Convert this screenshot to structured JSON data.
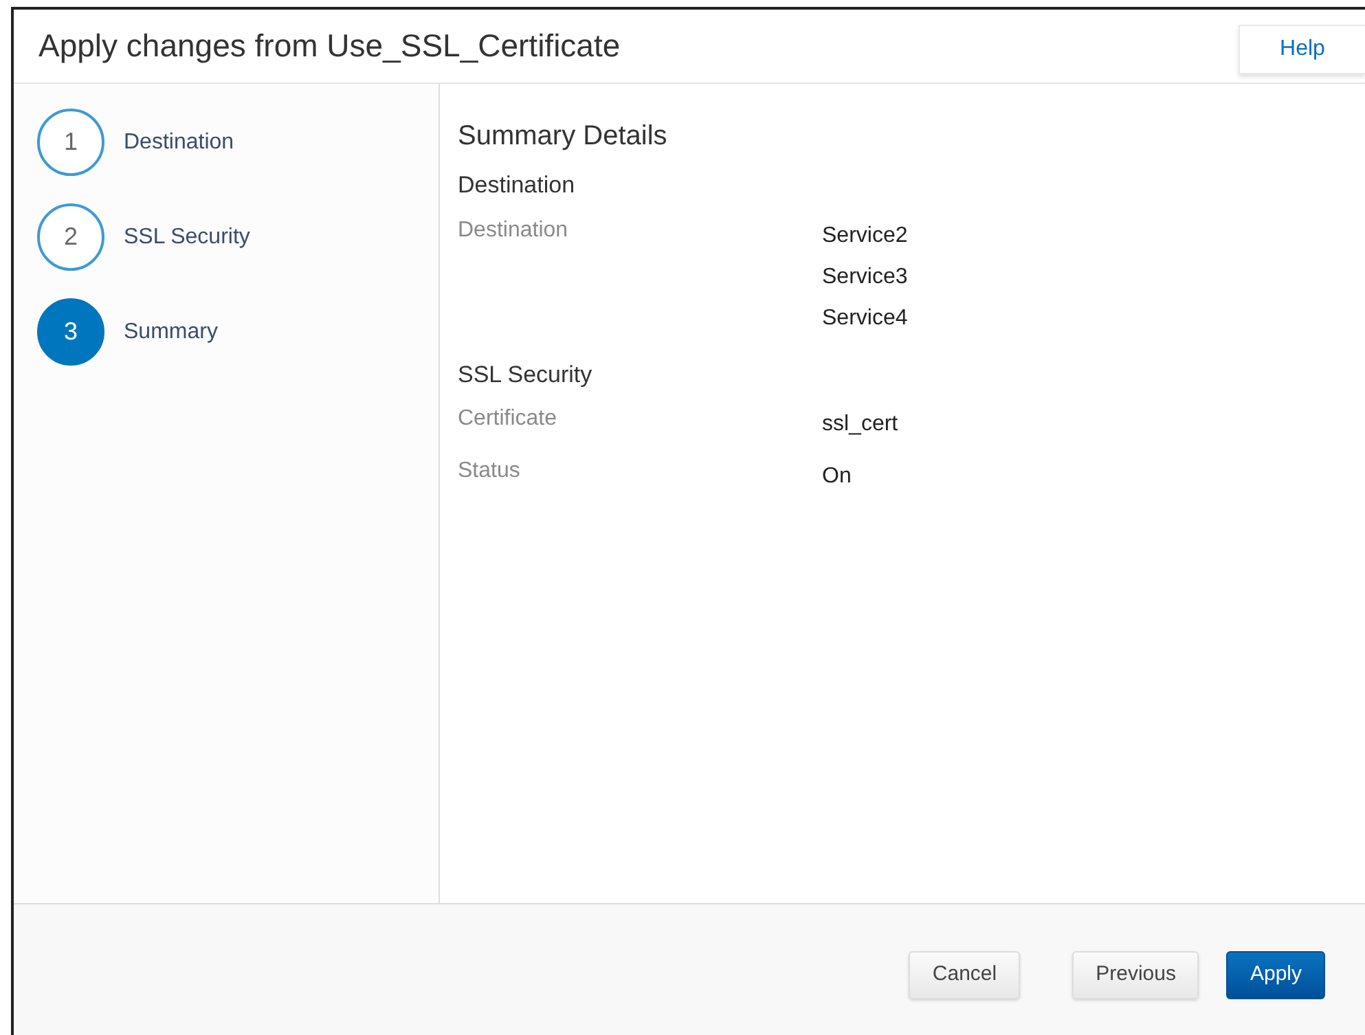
{
  "window": {
    "title": "Apply changes from Use_SSL_Certificate",
    "help_button": "Help"
  },
  "steps": [
    {
      "number": "1",
      "label": "Destination",
      "selected": false
    },
    {
      "number": "2",
      "label": "SSL Security",
      "selected": false
    },
    {
      "number": "3",
      "label": "Summary",
      "selected": true
    }
  ],
  "summary": {
    "heading": "Summary Details",
    "sections": [
      {
        "title": "Destination",
        "rows": [
          {
            "label": "Destination",
            "values": [
              "Service2",
              "Service3",
              "Service4"
            ]
          }
        ]
      },
      {
        "title": "SSL Security",
        "rows": [
          {
            "label": "Certificate",
            "values": [
              "ssl_cert"
            ]
          },
          {
            "label": "Status",
            "values": [
              "On"
            ]
          }
        ]
      }
    ]
  },
  "buttons": [
    {
      "label": "Cancel",
      "kind": "default"
    },
    {
      "label": "Previous",
      "kind": "default"
    },
    {
      "label": "Apply",
      "kind": "primary"
    }
  ]
}
